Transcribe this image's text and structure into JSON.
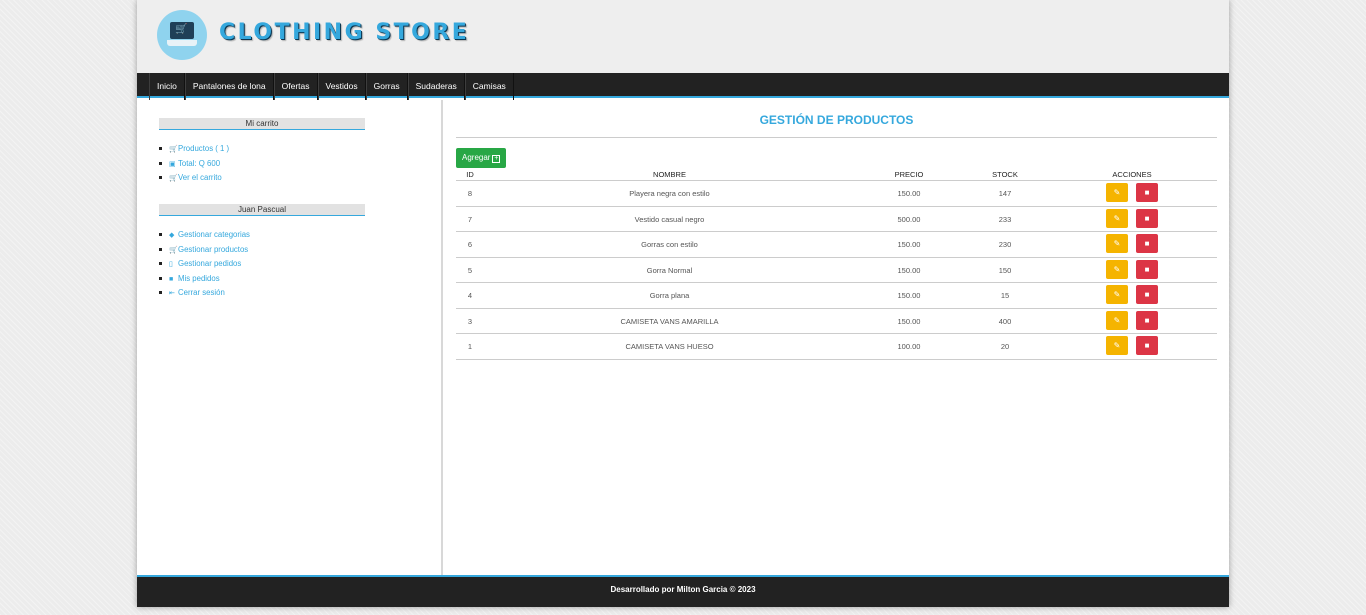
{
  "header": {
    "title": "CLOTHING STORE"
  },
  "nav": [
    "Inicio",
    "Pantalones de lona",
    "Ofertas",
    "Vestidos",
    "Gorras",
    "Sudaderas",
    "Camisas"
  ],
  "cart": {
    "title": "Mi carrito",
    "items": [
      {
        "icon": "cart-icon",
        "label": "Productos ( 1 )"
      },
      {
        "icon": "cash-icon",
        "label": "Total: Q 600"
      },
      {
        "icon": "cart-icon",
        "label": "Ver el carrito"
      }
    ]
  },
  "user": {
    "name": "Juan Pascual",
    "items": [
      {
        "icon": "tag-icon",
        "label": "Gestionar categorias"
      },
      {
        "icon": "cart-icon",
        "label": "Gestionar productos"
      },
      {
        "icon": "clipboard-icon",
        "label": "Gestionar pedidos"
      },
      {
        "icon": "receipt-icon",
        "label": "Mis pedidos"
      },
      {
        "icon": "logout-icon",
        "label": "Cerrar sesión"
      }
    ]
  },
  "main": {
    "title": "GESTIÓN DE PRODUCTOS",
    "add_label": "Agregar",
    "columns": {
      "id": "ID",
      "name": "NOMBRE",
      "price": "PRECIO",
      "stock": "STOCK",
      "actions": "ACCIONES"
    },
    "rows": [
      {
        "id": "8",
        "name": "Playera negra con estilo",
        "price": "150.00",
        "stock": "147"
      },
      {
        "id": "7",
        "name": "Vestido casual negro",
        "price": "500.00",
        "stock": "233"
      },
      {
        "id": "6",
        "name": "Gorras con estilo",
        "price": "150.00",
        "stock": "230"
      },
      {
        "id": "5",
        "name": "Gorra Normal",
        "price": "150.00",
        "stock": "150"
      },
      {
        "id": "4",
        "name": "Gorra plana",
        "price": "150.00",
        "stock": "15"
      },
      {
        "id": "3",
        "name": "CAMISETA VANS AMARILLA",
        "price": "150.00",
        "stock": "400"
      },
      {
        "id": "1",
        "name": "CAMISETA VANS HUESO",
        "price": "100.00",
        "stock": "20"
      }
    ]
  },
  "footer": {
    "text": "Desarrollado por Milton Garcia © 2023"
  },
  "colors": {
    "accent": "#35a8dd",
    "edit": "#f5b400",
    "delete": "#dc3545",
    "add": "#28a745"
  }
}
